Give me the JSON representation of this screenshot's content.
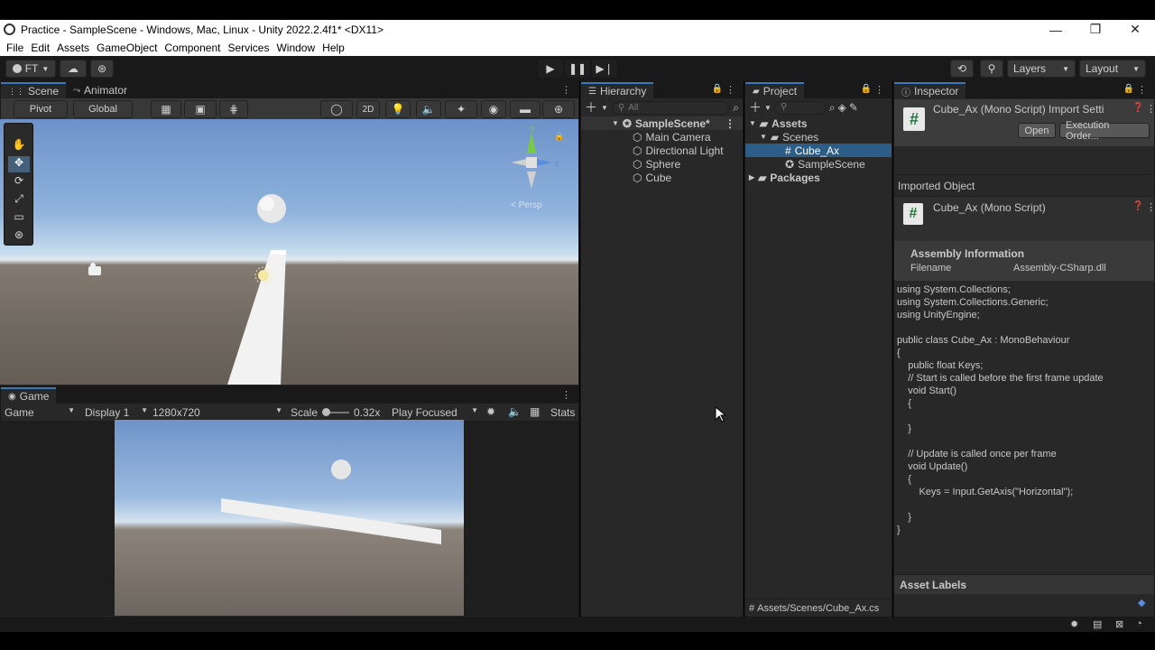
{
  "window": {
    "title": "Practice - SampleScene - Windows, Mac, Linux - Unity 2022.2.4f1* <DX11>",
    "minimize": "—",
    "restore": "❐",
    "close": "✕"
  },
  "menu": [
    "File",
    "Edit",
    "Assets",
    "GameObject",
    "Component",
    "Services",
    "Window",
    "Help"
  ],
  "toolbar": {
    "account": "FT",
    "layers": "Layers",
    "layout": "Layout"
  },
  "scene": {
    "tabs": [
      "Scene",
      "Animator"
    ],
    "pivot": "Pivot",
    "global": "Global",
    "mode_2d": "2D",
    "persp_label": "< Persp"
  },
  "game": {
    "tab": "Game",
    "view_select": "Game",
    "display": "Display 1",
    "resolution": "1280x720",
    "scale_label": "Scale",
    "scale_value": "0.32x",
    "play_mode": "Play Focused",
    "stats": "Stats"
  },
  "hierarchy": {
    "tab": "Hierarchy",
    "search_placeholder": "All",
    "scene_name": "SampleScene*",
    "items": [
      "Main Camera",
      "Directional Light",
      "Sphere",
      "Cube"
    ]
  },
  "project": {
    "tab": "Project",
    "assets": "Assets",
    "scenes": "Scenes",
    "file_selected": "Cube_Ax",
    "file_scene": "SampleScene",
    "packages": "Packages",
    "path": "Assets/Scenes/Cube_Ax.cs"
  },
  "inspector": {
    "tab": "Inspector",
    "header_title": "Cube_Ax (Mono Script) Import Setti",
    "open_button": "Open",
    "exec_order_button": "Execution Order...",
    "imported_object": "Imported Object",
    "object_title": "Cube_Ax (Mono Script)",
    "assembly_info": "Assembly Information",
    "filename_label": "Filename",
    "filename_value": "Assembly-CSharp.dll",
    "code": [
      "using System.Collections;",
      "using System.Collections.Generic;",
      "using UnityEngine;",
      "",
      "public class Cube_Ax : MonoBehaviour",
      "{",
      "    public float Keys;",
      "    // Start is called before the first frame update",
      "    void Start()",
      "    {",
      "",
      "    }",
      "",
      "    // Update is called once per frame",
      "    void Update()",
      "    {",
      "        Keys = Input.GetAxis(\"Horizontal\");",
      "",
      "    }",
      "}"
    ],
    "asset_labels": "Asset Labels"
  },
  "colors": {
    "accent": "#3a79bb",
    "selection": "#2c5d87",
    "panel": "#282828",
    "toolbar": "#191919"
  }
}
